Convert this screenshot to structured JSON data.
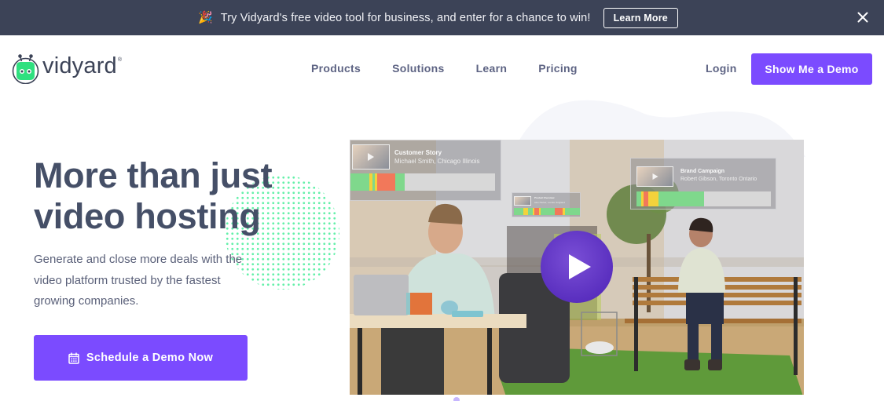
{
  "banner": {
    "emoji": "🎉",
    "text": "Try Vidyard's free video tool for business, and enter for a chance to win!",
    "button_label": "Learn More",
    "close_icon": "close-icon"
  },
  "header": {
    "logo_text": "vidyard",
    "logo_reg": "®",
    "nav": [
      {
        "label": "Products"
      },
      {
        "label": "Solutions"
      },
      {
        "label": "Learn"
      },
      {
        "label": "Pricing"
      }
    ],
    "login_label": "Login",
    "demo_button_label": "Show Me a Demo"
  },
  "hero": {
    "title_lines": [
      "More than just",
      "video hosting"
    ],
    "subtitle_lines": [
      "Generate and close more deals with the",
      "video platform trusted by the fastest",
      "growing companies."
    ],
    "cta_label": "Schedule a Demo Now",
    "cta_icon": "calendar-icon"
  },
  "video": {
    "play_icon": "play-icon",
    "overlay_cards": [
      {
        "title": "Customer Story",
        "subtitle": "Michael Smith, Chicago Illinois"
      },
      {
        "title": "Product Overview",
        "subtitle": "Alex Parker, London England"
      },
      {
        "title": "Brand Campaign",
        "subtitle": "Robert Gibson, Toronto Ontario"
      }
    ]
  },
  "colors": {
    "brand_purple": "#7b4bff",
    "banner_bg": "#3c4357",
    "heading": "#454f67",
    "dots_green": "#5cf0a6",
    "logo_green": "#2fe07f"
  }
}
